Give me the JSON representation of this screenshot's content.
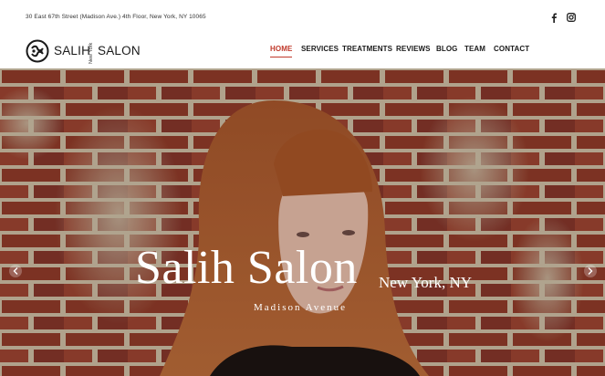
{
  "topbar": {
    "address": "30 East 67th Street (Madison Ave.) 4th Floor, New York, NY 10065",
    "social": [
      {
        "icon": "facebook-icon"
      },
      {
        "icon": "instagram-icon"
      }
    ]
  },
  "logo": {
    "name_part1": "SALIH",
    "name_sub": "New York",
    "name_part2": "SALON"
  },
  "nav": {
    "items": [
      "HOME",
      "SERVICES",
      "TREATMENTS",
      "REVIEWS",
      "BLOG",
      "TEAM",
      "CONTACT"
    ],
    "active": "HOME",
    "active_color": "#c0392b"
  },
  "hero": {
    "title": "Salih Salon",
    "city": "New York, NY",
    "subtitle": "Madison Avenue",
    "prev_icon": "chevron-left-icon",
    "next_icon": "chevron-right-icon"
  }
}
